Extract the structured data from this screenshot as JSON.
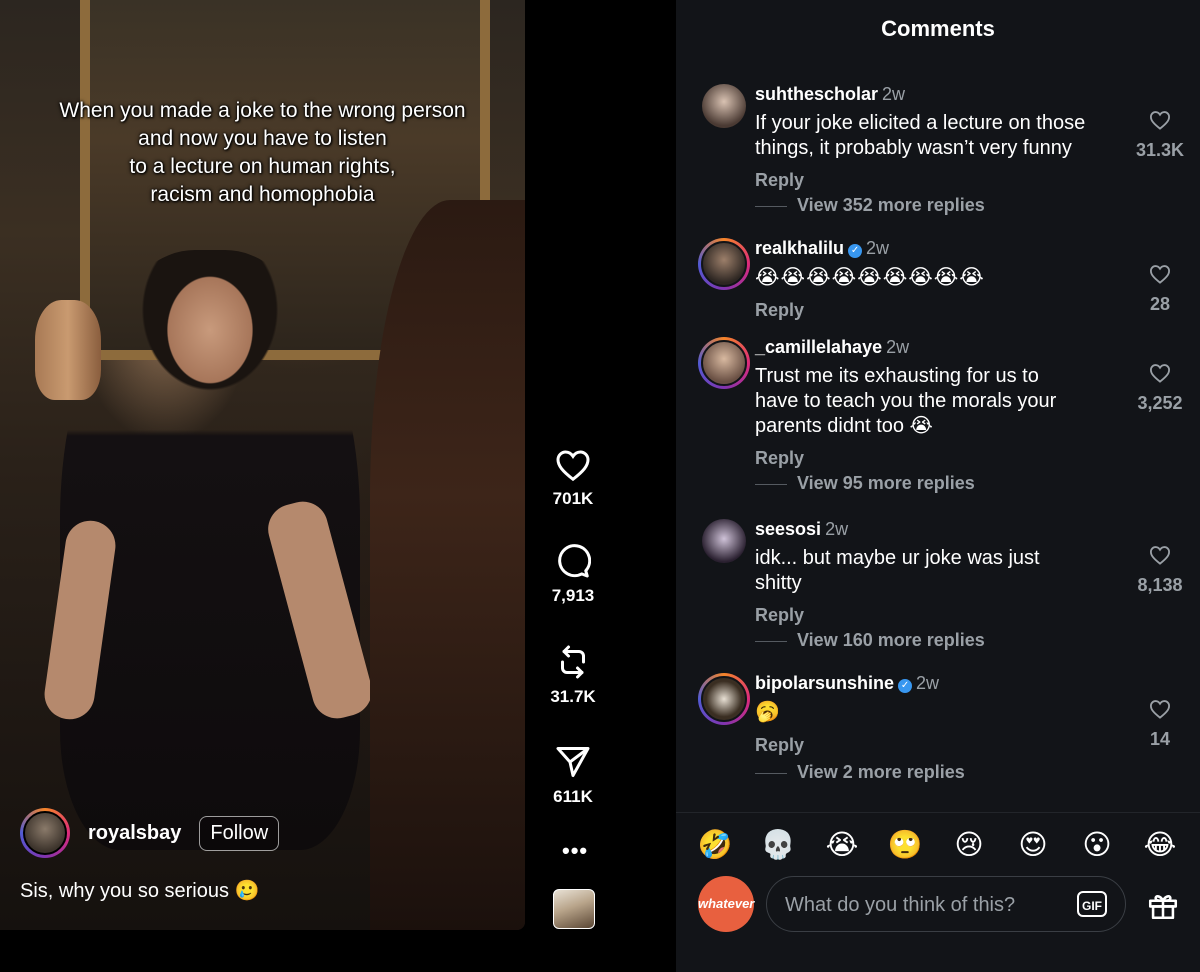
{
  "video": {
    "overlay_caption": "When you made a joke to the wrong person\nand now you have to listen\nto a lecture on human rights,\nracism and homophobia",
    "author": "royalsbay",
    "follow_label": "Follow",
    "caption": "Sis, why you so serious 🥲"
  },
  "actions": {
    "likes": "701K",
    "comments": "7,913",
    "reposts": "31.7K",
    "shares": "611K",
    "more": "•••"
  },
  "comments_panel": {
    "title": "Comments",
    "reply_label": "Reply",
    "items": [
      {
        "user": "suhthescholar",
        "time": "2w",
        "verified": false,
        "text": "If your joke elicited a lecture on those\nthings, it probably wasn’t very funny",
        "likes": "31.3K",
        "more_replies": "View 352 more replies"
      },
      {
        "user": "realkhalilu",
        "time": "2w",
        "verified": true,
        "text": "😭😭😭😭😭😭😭😭😭",
        "likes": "28",
        "more_replies": ""
      },
      {
        "user": "_camillelahaye",
        "time": "2w",
        "verified": false,
        "text": "Trust me its exhausting for us to\nhave to teach you the morals your\nparents didnt too 😭",
        "likes": "3,252",
        "more_replies": "View 95 more replies"
      },
      {
        "user": "seesosi",
        "time": "2w",
        "verified": false,
        "text": "idk... but maybe ur joke was just\nshitty",
        "likes": "8,138",
        "more_replies": "View 160 more replies"
      },
      {
        "user": "bipolarsunshine",
        "time": "2w",
        "verified": true,
        "text": "🥱",
        "likes": "14",
        "more_replies": "View 2 more replies"
      }
    ],
    "quick_emojis": [
      "🤣",
      "💀",
      "😭",
      "🙄",
      "😢",
      "😍",
      "😮",
      "😂"
    ],
    "composer": {
      "avatar_text": "whatever",
      "placeholder": "What do you think of this?",
      "gif_label": "GIF"
    }
  },
  "colors": {
    "panel_bg": "#121418",
    "muted_text": "#9aa0a6",
    "verified_blue": "#3897f0",
    "avatar_orange": "#e8603f"
  }
}
